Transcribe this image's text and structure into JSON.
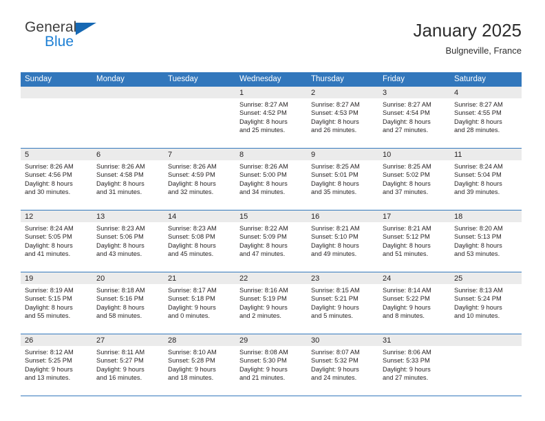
{
  "brand": {
    "name_top": "General",
    "name_bottom": "Blue",
    "accent_color": "#1668b3",
    "blue_text_color": "#1c7fd4"
  },
  "header": {
    "title": "January 2025",
    "subtitle": "Bulgneville, France"
  },
  "theme": {
    "header_row_bg": "#3277bc",
    "day_number_bg": "#ebebeb",
    "text_color": "#231f20"
  },
  "weekdays": [
    "Sunday",
    "Monday",
    "Tuesday",
    "Wednesday",
    "Thursday",
    "Friday",
    "Saturday"
  ],
  "weeks": [
    [
      {
        "day": "",
        "sunrise": "",
        "sunset": "",
        "daylight1": "",
        "daylight2": ""
      },
      {
        "day": "",
        "sunrise": "",
        "sunset": "",
        "daylight1": "",
        "daylight2": ""
      },
      {
        "day": "",
        "sunrise": "",
        "sunset": "",
        "daylight1": "",
        "daylight2": ""
      },
      {
        "day": "1",
        "sunrise": "Sunrise: 8:27 AM",
        "sunset": "Sunset: 4:52 PM",
        "daylight1": "Daylight: 8 hours",
        "daylight2": "and 25 minutes."
      },
      {
        "day": "2",
        "sunrise": "Sunrise: 8:27 AM",
        "sunset": "Sunset: 4:53 PM",
        "daylight1": "Daylight: 8 hours",
        "daylight2": "and 26 minutes."
      },
      {
        "day": "3",
        "sunrise": "Sunrise: 8:27 AM",
        "sunset": "Sunset: 4:54 PM",
        "daylight1": "Daylight: 8 hours",
        "daylight2": "and 27 minutes."
      },
      {
        "day": "4",
        "sunrise": "Sunrise: 8:27 AM",
        "sunset": "Sunset: 4:55 PM",
        "daylight1": "Daylight: 8 hours",
        "daylight2": "and 28 minutes."
      }
    ],
    [
      {
        "day": "5",
        "sunrise": "Sunrise: 8:26 AM",
        "sunset": "Sunset: 4:56 PM",
        "daylight1": "Daylight: 8 hours",
        "daylight2": "and 30 minutes."
      },
      {
        "day": "6",
        "sunrise": "Sunrise: 8:26 AM",
        "sunset": "Sunset: 4:58 PM",
        "daylight1": "Daylight: 8 hours",
        "daylight2": "and 31 minutes."
      },
      {
        "day": "7",
        "sunrise": "Sunrise: 8:26 AM",
        "sunset": "Sunset: 4:59 PM",
        "daylight1": "Daylight: 8 hours",
        "daylight2": "and 32 minutes."
      },
      {
        "day": "8",
        "sunrise": "Sunrise: 8:26 AM",
        "sunset": "Sunset: 5:00 PM",
        "daylight1": "Daylight: 8 hours",
        "daylight2": "and 34 minutes."
      },
      {
        "day": "9",
        "sunrise": "Sunrise: 8:25 AM",
        "sunset": "Sunset: 5:01 PM",
        "daylight1": "Daylight: 8 hours",
        "daylight2": "and 35 minutes."
      },
      {
        "day": "10",
        "sunrise": "Sunrise: 8:25 AM",
        "sunset": "Sunset: 5:02 PM",
        "daylight1": "Daylight: 8 hours",
        "daylight2": "and 37 minutes."
      },
      {
        "day": "11",
        "sunrise": "Sunrise: 8:24 AM",
        "sunset": "Sunset: 5:04 PM",
        "daylight1": "Daylight: 8 hours",
        "daylight2": "and 39 minutes."
      }
    ],
    [
      {
        "day": "12",
        "sunrise": "Sunrise: 8:24 AM",
        "sunset": "Sunset: 5:05 PM",
        "daylight1": "Daylight: 8 hours",
        "daylight2": "and 41 minutes."
      },
      {
        "day": "13",
        "sunrise": "Sunrise: 8:23 AM",
        "sunset": "Sunset: 5:06 PM",
        "daylight1": "Daylight: 8 hours",
        "daylight2": "and 43 minutes."
      },
      {
        "day": "14",
        "sunrise": "Sunrise: 8:23 AM",
        "sunset": "Sunset: 5:08 PM",
        "daylight1": "Daylight: 8 hours",
        "daylight2": "and 45 minutes."
      },
      {
        "day": "15",
        "sunrise": "Sunrise: 8:22 AM",
        "sunset": "Sunset: 5:09 PM",
        "daylight1": "Daylight: 8 hours",
        "daylight2": "and 47 minutes."
      },
      {
        "day": "16",
        "sunrise": "Sunrise: 8:21 AM",
        "sunset": "Sunset: 5:10 PM",
        "daylight1": "Daylight: 8 hours",
        "daylight2": "and 49 minutes."
      },
      {
        "day": "17",
        "sunrise": "Sunrise: 8:21 AM",
        "sunset": "Sunset: 5:12 PM",
        "daylight1": "Daylight: 8 hours",
        "daylight2": "and 51 minutes."
      },
      {
        "day": "18",
        "sunrise": "Sunrise: 8:20 AM",
        "sunset": "Sunset: 5:13 PM",
        "daylight1": "Daylight: 8 hours",
        "daylight2": "and 53 minutes."
      }
    ],
    [
      {
        "day": "19",
        "sunrise": "Sunrise: 8:19 AM",
        "sunset": "Sunset: 5:15 PM",
        "daylight1": "Daylight: 8 hours",
        "daylight2": "and 55 minutes."
      },
      {
        "day": "20",
        "sunrise": "Sunrise: 8:18 AM",
        "sunset": "Sunset: 5:16 PM",
        "daylight1": "Daylight: 8 hours",
        "daylight2": "and 58 minutes."
      },
      {
        "day": "21",
        "sunrise": "Sunrise: 8:17 AM",
        "sunset": "Sunset: 5:18 PM",
        "daylight1": "Daylight: 9 hours",
        "daylight2": "and 0 minutes."
      },
      {
        "day": "22",
        "sunrise": "Sunrise: 8:16 AM",
        "sunset": "Sunset: 5:19 PM",
        "daylight1": "Daylight: 9 hours",
        "daylight2": "and 2 minutes."
      },
      {
        "day": "23",
        "sunrise": "Sunrise: 8:15 AM",
        "sunset": "Sunset: 5:21 PM",
        "daylight1": "Daylight: 9 hours",
        "daylight2": "and 5 minutes."
      },
      {
        "day": "24",
        "sunrise": "Sunrise: 8:14 AM",
        "sunset": "Sunset: 5:22 PM",
        "daylight1": "Daylight: 9 hours",
        "daylight2": "and 8 minutes."
      },
      {
        "day": "25",
        "sunrise": "Sunrise: 8:13 AM",
        "sunset": "Sunset: 5:24 PM",
        "daylight1": "Daylight: 9 hours",
        "daylight2": "and 10 minutes."
      }
    ],
    [
      {
        "day": "26",
        "sunrise": "Sunrise: 8:12 AM",
        "sunset": "Sunset: 5:25 PM",
        "daylight1": "Daylight: 9 hours",
        "daylight2": "and 13 minutes."
      },
      {
        "day": "27",
        "sunrise": "Sunrise: 8:11 AM",
        "sunset": "Sunset: 5:27 PM",
        "daylight1": "Daylight: 9 hours",
        "daylight2": "and 16 minutes."
      },
      {
        "day": "28",
        "sunrise": "Sunrise: 8:10 AM",
        "sunset": "Sunset: 5:28 PM",
        "daylight1": "Daylight: 9 hours",
        "daylight2": "and 18 minutes."
      },
      {
        "day": "29",
        "sunrise": "Sunrise: 8:08 AM",
        "sunset": "Sunset: 5:30 PM",
        "daylight1": "Daylight: 9 hours",
        "daylight2": "and 21 minutes."
      },
      {
        "day": "30",
        "sunrise": "Sunrise: 8:07 AM",
        "sunset": "Sunset: 5:32 PM",
        "daylight1": "Daylight: 9 hours",
        "daylight2": "and 24 minutes."
      },
      {
        "day": "31",
        "sunrise": "Sunrise: 8:06 AM",
        "sunset": "Sunset: 5:33 PM",
        "daylight1": "Daylight: 9 hours",
        "daylight2": "and 27 minutes."
      },
      {
        "day": "",
        "sunrise": "",
        "sunset": "",
        "daylight1": "",
        "daylight2": ""
      }
    ]
  ]
}
